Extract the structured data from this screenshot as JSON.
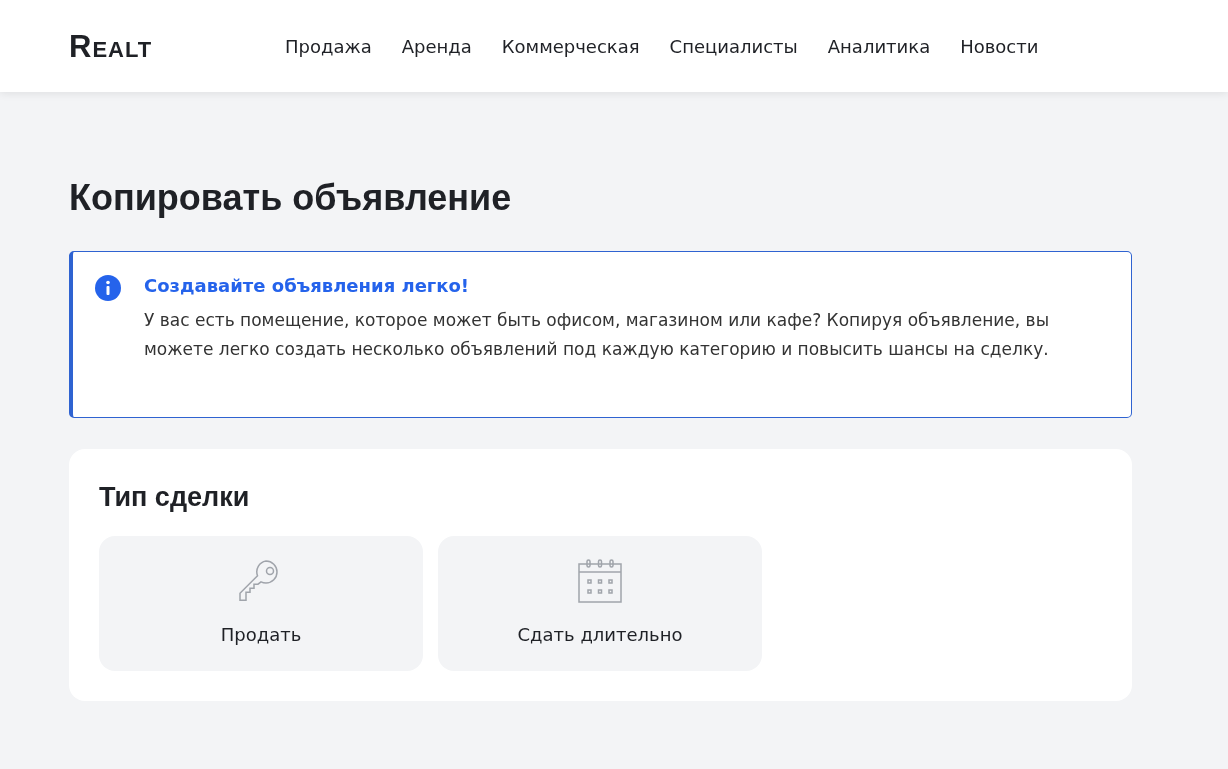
{
  "header": {
    "logo": "Realt",
    "nav": [
      "Продажа",
      "Аренда",
      "Коммерческая",
      "Специалисты",
      "Аналитика",
      "Новости"
    ]
  },
  "page_title": "Копировать объявление",
  "info": {
    "title": "Создавайте объявления легко!",
    "text": "У вас есть помещение, которое может быть офисом, магазином или кафе? Копируя объявление, вы можете легко создать несколько объявлений под каждую категорию и повысить шансы на сделку."
  },
  "deal_type": {
    "title": "Тип сделки",
    "options": [
      {
        "label": "Продать",
        "kind": "key"
      },
      {
        "label": "Сдать длительно",
        "kind": "calendar"
      }
    ]
  }
}
